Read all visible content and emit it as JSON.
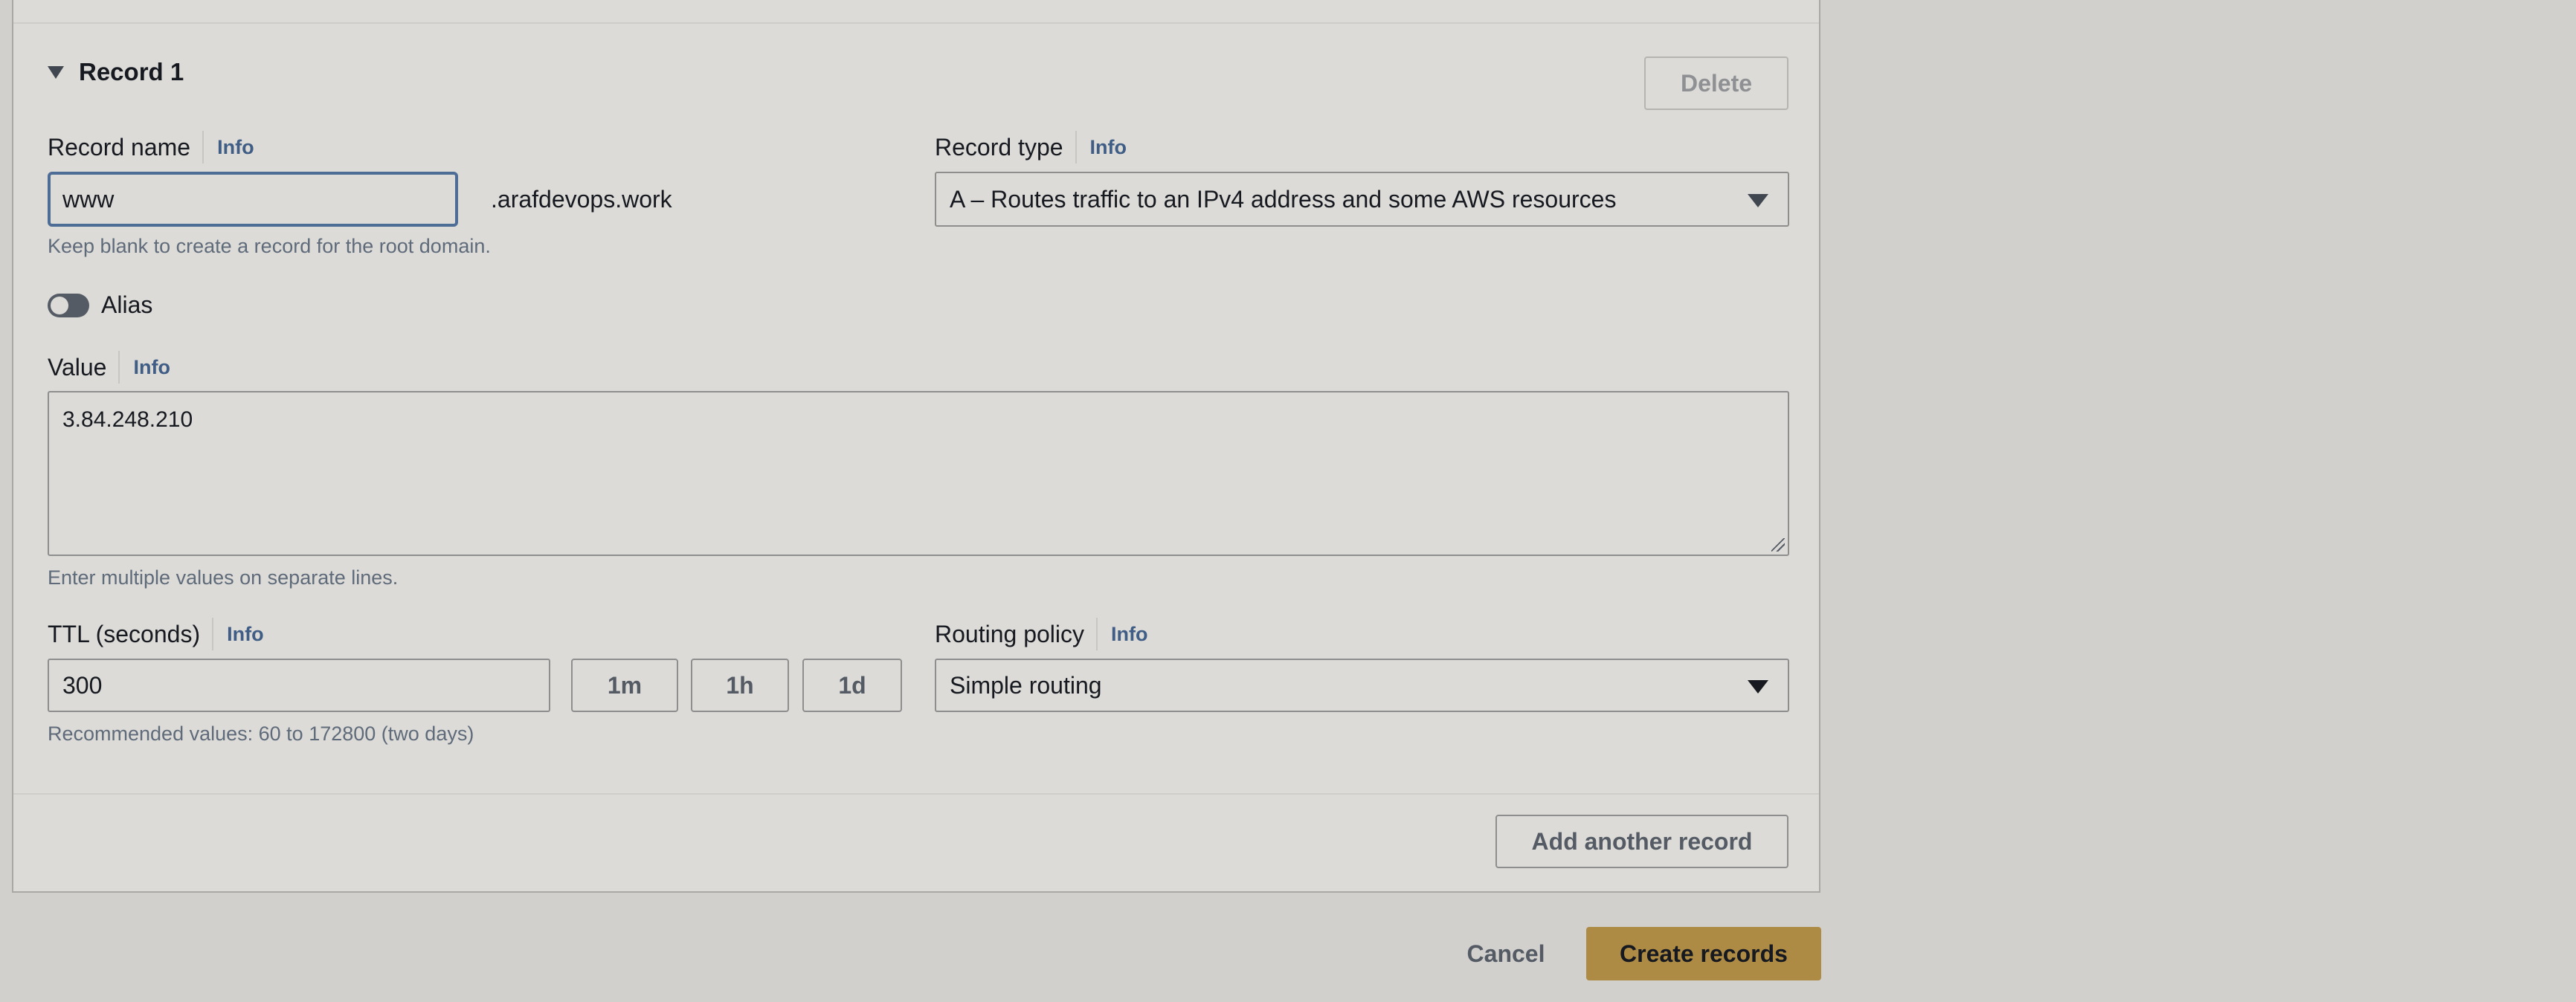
{
  "record": {
    "title": "Record 1",
    "delete_label": "Delete"
  },
  "record_name": {
    "label": "Record name",
    "info": "Info",
    "value": "www",
    "domain_suffix": ".arafdevops.work",
    "hint": "Keep blank to create a record for the root domain."
  },
  "record_type": {
    "label": "Record type",
    "info": "Info",
    "selected": "A – Routes traffic to an IPv4 address and some AWS resources"
  },
  "alias": {
    "label": "Alias",
    "enabled": false
  },
  "value": {
    "label": "Value",
    "info": "Info",
    "text": "3.84.248.210",
    "hint": "Enter multiple values on separate lines."
  },
  "ttl": {
    "label": "TTL (seconds)",
    "info": "Info",
    "value": "300",
    "presets": [
      "1m",
      "1h",
      "1d"
    ],
    "hint": "Recommended values: 60 to 172800 (two days)"
  },
  "routing_policy": {
    "label": "Routing policy",
    "info": "Info",
    "selected": "Simple routing"
  },
  "footer": {
    "add_record_label": "Add another record",
    "cancel_label": "Cancel",
    "create_label": "Create records"
  },
  "colors": {
    "primary_button": "#ae8b44",
    "info_link": "#3f5d85",
    "focus_border": "#4d6d96"
  },
  "icons": {
    "expand": "caret-down-icon",
    "select": "triangle-down-icon",
    "resize": "resize-grip-icon"
  }
}
